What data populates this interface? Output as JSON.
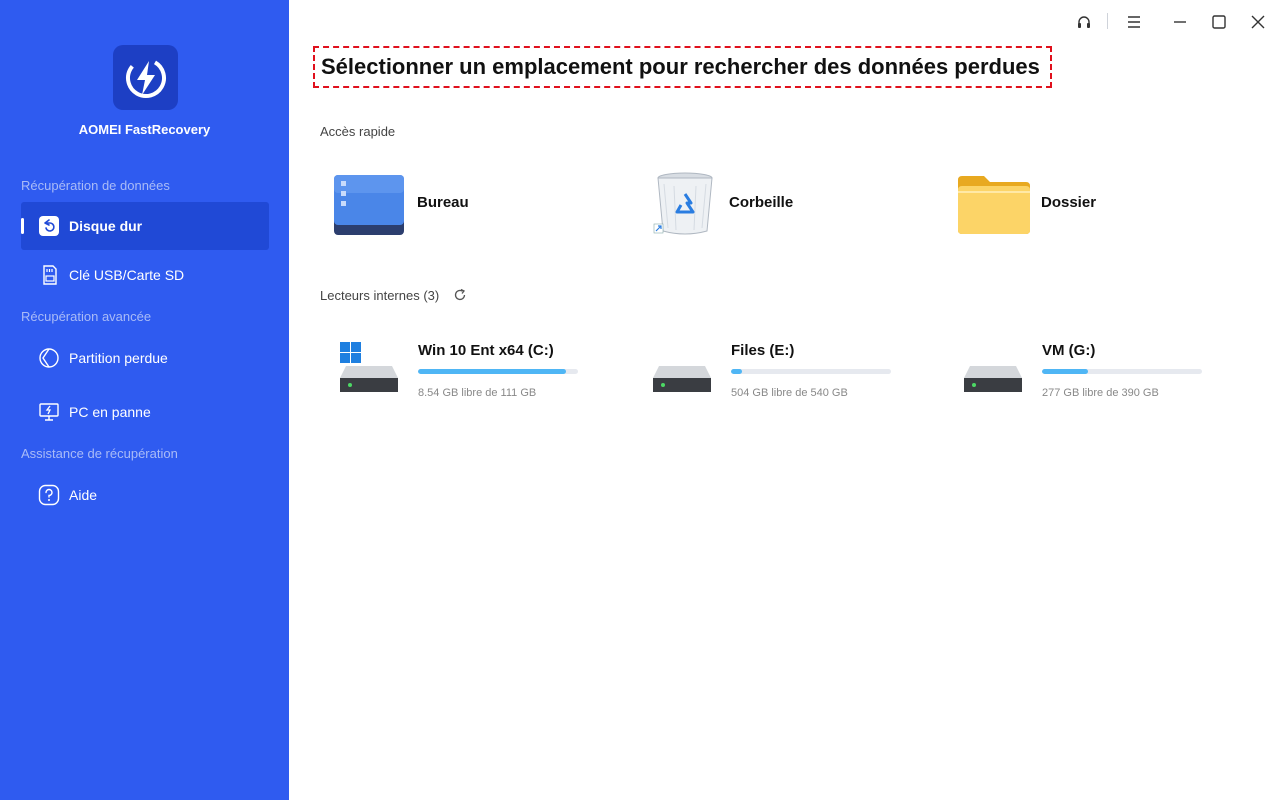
{
  "app": {
    "name": "AOMEI FastRecovery"
  },
  "sidebar": {
    "sections": [
      {
        "label": "Récupération de données"
      },
      {
        "label": "Récupération avancée"
      },
      {
        "label": "Assistance de récupération"
      }
    ],
    "items": [
      {
        "label": "Disque dur",
        "icon": "hard-disk-restore-icon",
        "active": true
      },
      {
        "label": "Clé USB/Carte SD",
        "icon": "sd-card-icon"
      },
      {
        "label": "Partition perdue",
        "icon": "lost-partition-icon"
      },
      {
        "label": "PC en panne",
        "icon": "crashed-pc-icon"
      },
      {
        "label": "Aide",
        "icon": "help-icon"
      }
    ]
  },
  "titlebar": {
    "icons": [
      "headset-icon",
      "menu-icon",
      "minimize-icon",
      "maximize-icon",
      "close-icon"
    ]
  },
  "main": {
    "title": "Sélectionner un emplacement pour rechercher des données perdues",
    "quick_access": {
      "label": "Accès rapide",
      "items": [
        {
          "label": "Bureau",
          "icon": "desktop-icon"
        },
        {
          "label": "Corbeille",
          "icon": "recycle-bin-icon"
        },
        {
          "label": "Dossier",
          "icon": "folder-icon"
        }
      ]
    },
    "drives": {
      "label": "Lecteurs internes (3)",
      "items": [
        {
          "name": "Win 10 Ent x64 (C:)",
          "free": "8.54 GB libre de 111 GB",
          "used_fraction": 0.923,
          "system": true
        },
        {
          "name": "Files (E:)",
          "free": "504 GB libre de 540 GB",
          "used_fraction": 0.067,
          "system": false
        },
        {
          "name": "VM (G:)",
          "free": "277 GB libre de 390 GB",
          "used_fraction": 0.29,
          "system": false
        }
      ]
    }
  },
  "colors": {
    "sidebar": "#2f5bf0",
    "sidebar_active": "#2049d6",
    "accent_bar": "#4fb6f5",
    "title_border": "#e0101c"
  }
}
